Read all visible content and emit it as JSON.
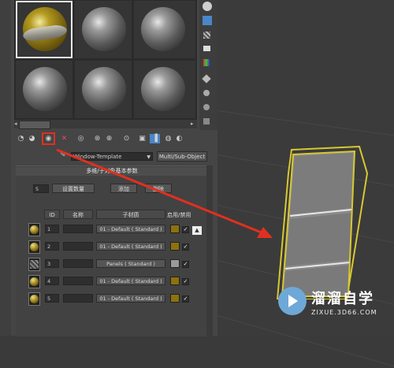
{
  "nameField": "Window-Template",
  "typeButton": "Multi/Sub-Object",
  "rolloutTitle": "多维/子对象基本参数",
  "countValue": "5",
  "setCountButton": "设置数量",
  "addButton": "添加",
  "deleteButton": "删除",
  "columns": {
    "id": "ID",
    "name": "名称",
    "submaterial": "子材质",
    "enable": "启用/禁用"
  },
  "rows": [
    {
      "id": "1",
      "name": "",
      "submaterial": "01 - Default ( Standard )",
      "swatch": "#8c7210",
      "thumb": "sphere"
    },
    {
      "id": "2",
      "name": "",
      "submaterial": "01 - Default ( Standard )",
      "swatch": "#8c7210",
      "thumb": "sphere"
    },
    {
      "id": "3",
      "name": "",
      "submaterial": "Panels ( Standard )",
      "swatch": "#9a9a9a",
      "thumb": "panel"
    },
    {
      "id": "4",
      "name": "",
      "submaterial": "01 - Default ( Standard )",
      "swatch": "#8c7210",
      "thumb": "sphere"
    },
    {
      "id": "5",
      "name": "",
      "submaterial": "01 - Default ( Standard )",
      "swatch": "#8c7210",
      "thumb": "sphere"
    }
  ],
  "checkMark": "✓",
  "logo": {
    "name": "溜溜自学",
    "url": "ZIXUE.3D66.COM"
  },
  "colors": {
    "highlight": "#e03020",
    "frame": "#d8c832",
    "arrow": "#e03020"
  }
}
